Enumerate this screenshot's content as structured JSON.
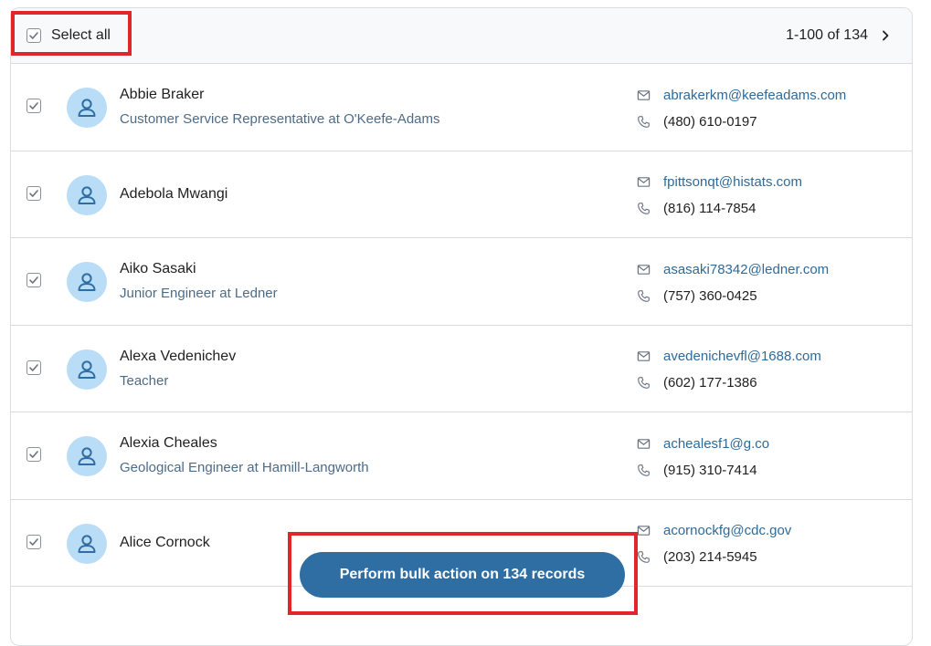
{
  "header": {
    "select_all_label": "Select all",
    "pagination": "1-100 of 134"
  },
  "contacts": [
    {
      "name": "Abbie Braker",
      "title": "Customer Service Representative at O'Keefe-Adams",
      "email": "abrakerkm@keefeadams.com",
      "phone": "(480) 610-0197",
      "checked": true
    },
    {
      "name": "Adebola Mwangi",
      "title": "",
      "email": "fpittsonqt@histats.com",
      "phone": "(816) 114-7854",
      "checked": true
    },
    {
      "name": "Aiko Sasaki",
      "title": "Junior Engineer at Ledner",
      "email": "asasaki78342@ledner.com",
      "phone": "(757) 360-0425",
      "checked": true
    },
    {
      "name": "Alexa Vedenichev",
      "title": "Teacher",
      "email": "avedenichevfl@1688.com",
      "phone": "(602) 177-1386",
      "checked": true
    },
    {
      "name": "Alexia Cheales",
      "title": "Geological Engineer at Hamill-Langworth",
      "email": "achealesf1@g.co",
      "phone": "(915) 310-7414",
      "checked": true
    },
    {
      "name": "Alice Cornock",
      "title": "",
      "email": "acornockfg@cdc.gov",
      "phone": "(203) 214-5945",
      "checked": true
    }
  ],
  "bulk_action": {
    "label": "Perform bulk action on 134 records"
  },
  "colors": {
    "accent": "#2f6ea3",
    "avatar_bg": "#b9dcf7",
    "highlight": "#e0262a",
    "email_link": "#2f6a98"
  }
}
